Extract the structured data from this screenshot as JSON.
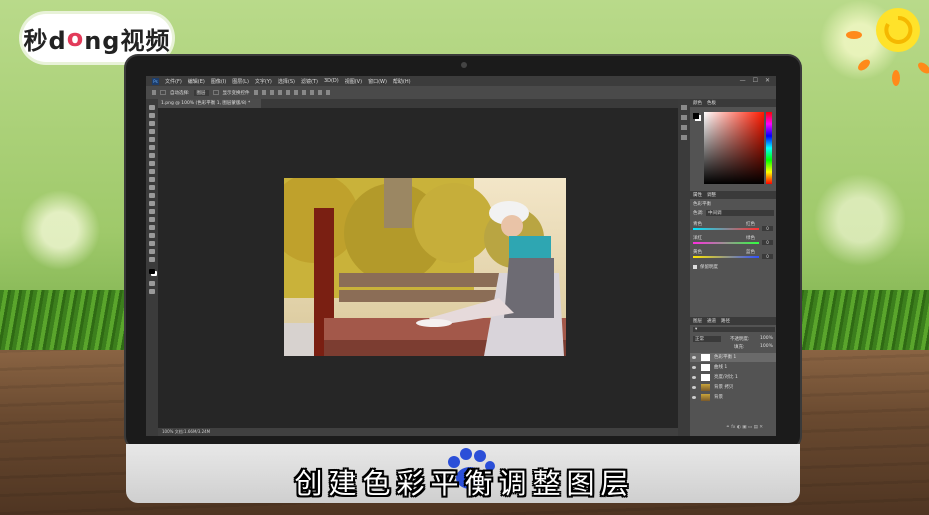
{
  "logo": {
    "text_pre": "秒d",
    "text_o": "o",
    "text_post": "ng视频"
  },
  "subtitle": "创建色彩平衡调整图层",
  "app": {
    "menu": [
      "文件(F)",
      "编辑(E)",
      "图像(I)",
      "图层(L)",
      "文字(Y)",
      "选择(S)",
      "滤镜(T)",
      "3D(D)",
      "视图(V)",
      "窗口(W)",
      "帮助(H)"
    ],
    "window_controls": [
      "—",
      "☐",
      "✕"
    ],
    "options": {
      "auto_select_label": "自动选择:",
      "auto_select_value": "图层",
      "show_transform": "显示变换控件"
    },
    "doc_tab": "1.png @ 100% (色彩平衡 1, 图层蒙版/8) *",
    "status": "100%    文档:1.66M/3.24M"
  },
  "panels": {
    "color_tabs": [
      "颜色",
      "色板"
    ],
    "props_tabs": [
      "属性",
      "调整"
    ],
    "props_title": "色彩平衡",
    "tone_label": "色调:",
    "tone_value": "中间调",
    "sliders": [
      {
        "left": "青色",
        "right": "红色",
        "value": "0",
        "color_l": "#00e5ff",
        "color_r": "#ff3030"
      },
      {
        "left": "洋红",
        "right": "绿色",
        "value": "0",
        "color_l": "#ff2de0",
        "color_r": "#30ff40"
      },
      {
        "left": "黄色",
        "right": "蓝色",
        "value": "0",
        "color_l": "#ffe600",
        "color_r": "#3050ff"
      }
    ],
    "preserve_luminosity": "保留明度",
    "layers_tabs": [
      "图层",
      "通道",
      "路径"
    ],
    "blend_mode": "正常",
    "opacity_label": "不透明度:",
    "opacity_value": "100%",
    "fill_label": "填充:",
    "fill_value": "100%",
    "layers": [
      {
        "name": "色彩平衡 1",
        "selected": true,
        "thumb": "white"
      },
      {
        "name": "曲线 1",
        "selected": false,
        "thumb": "white"
      },
      {
        "name": "亮度/对比 1",
        "selected": false,
        "thumb": "white"
      },
      {
        "name": "背景 拷贝",
        "selected": false,
        "thumb": "pic"
      },
      {
        "name": "背景",
        "selected": false,
        "thumb": "pic"
      }
    ]
  },
  "colors": {
    "accent_red": "#e23b5a",
    "ps_blue": "#6cb4ff"
  }
}
